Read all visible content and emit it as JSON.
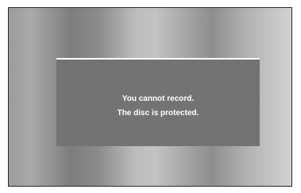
{
  "dialog": {
    "line1": "You cannot record.",
    "line2": "The disc is protected."
  },
  "colors": {
    "dialog_bg": "#737373",
    "dialog_text": "#ffffff",
    "dialog_top_rule": "#ffffff",
    "frame_border": "#2a2a2a"
  }
}
